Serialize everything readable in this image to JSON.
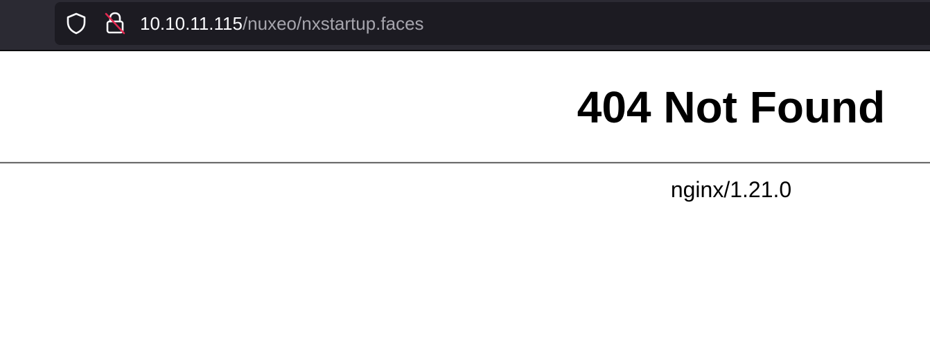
{
  "browser": {
    "url_host": "10.10.11.115",
    "url_path": "/nuxeo/nxstartup.faces",
    "icons": {
      "tracking_protection": "shield-icon",
      "connection_status": "insecure-lock-icon"
    },
    "colors": {
      "toolbar_bg": "#2b2a33",
      "urlbar_bg": "#1c1b22",
      "host_text": "#fbfbfe",
      "path_text": "#a6a5ad",
      "insecure_slash": "#e22850"
    }
  },
  "page": {
    "title": "404 Not Found",
    "server": "nginx/1.21.0"
  }
}
